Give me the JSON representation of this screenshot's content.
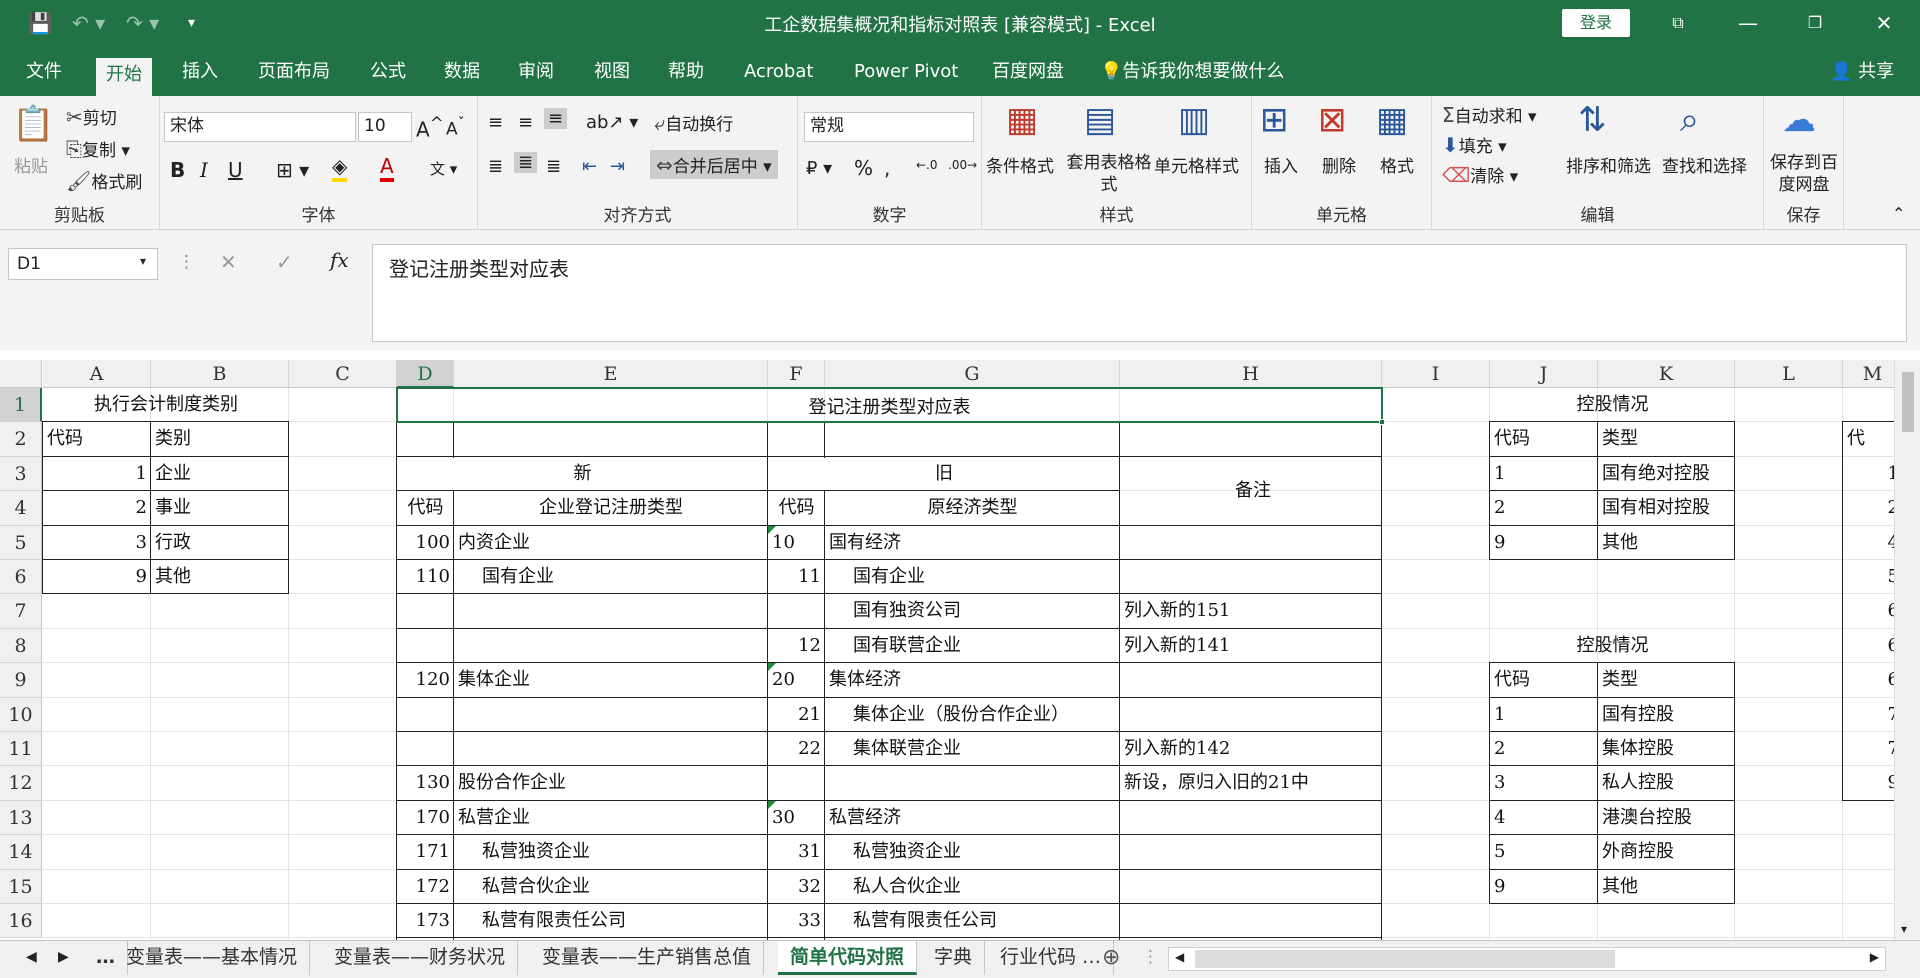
{
  "titlebar": {
    "title": "工企数据集概况和指标对照表  [兼容模式]  -  Excel",
    "login": "登录"
  },
  "menu": [
    "文件",
    "开始",
    "插入",
    "页面布局",
    "公式",
    "数据",
    "审阅",
    "视图",
    "帮助",
    "Acrobat",
    "Power Pivot",
    "百度网盘"
  ],
  "menu_search": "告诉我你想要做什么",
  "share": "共享",
  "ribbon": {
    "clipboard": {
      "paste": "粘贴",
      "cut": "剪切",
      "copy": "复制",
      "painter": "格式刷",
      "label": "剪贴板"
    },
    "font": {
      "name": "宋体",
      "size": "10",
      "bold": "B",
      "italic": "I",
      "underline": "U",
      "label": "字体"
    },
    "align": {
      "wrap": "自动换行",
      "merge": "合并后居中",
      "label": "对齐方式"
    },
    "number": {
      "format": "常规",
      "label": "数字"
    },
    "styles": {
      "cond": "条件格式",
      "table": "套用表格格式",
      "cell": "单元格样式",
      "label": "样式"
    },
    "cells": {
      "insert": "插入",
      "delete": "删除",
      "format": "格式",
      "label": "单元格"
    },
    "edit": {
      "autosum": "自动求和",
      "fill": "填充",
      "clear": "清除",
      "sort": "排序和筛选",
      "find": "查找和选择",
      "label": "编辑"
    },
    "save": {
      "baidu": "保存到百度网盘",
      "label": "保存"
    }
  },
  "formula": {
    "namebox": "D1",
    "content": "登记注册类型对应表"
  },
  "columns": [
    "A",
    "B",
    "C",
    "D",
    "E",
    "F",
    "G",
    "H",
    "I",
    "J",
    "K",
    "L",
    "M"
  ],
  "rows": [
    "1",
    "2",
    "3",
    "4",
    "5",
    "6",
    "7",
    "8",
    "9",
    "10",
    "11",
    "12",
    "13",
    "14",
    "15",
    "16"
  ],
  "sheet": {
    "A1": "执行会计制度类别",
    "A2": "代码",
    "B2": "类别",
    "A3": "1",
    "B3": "企业",
    "A4": "2",
    "B4": "事业",
    "A5": "3",
    "B5": "行政",
    "A6": "9",
    "B6": "其他",
    "D1": "登记注册类型对应表",
    "E3": "新",
    "G3": "旧",
    "H3": "备注",
    "D4": "代码",
    "E4": "企业登记注册类型",
    "F4": "代码",
    "G4": "原经济类型",
    "D5": "100",
    "E5": "内资企业",
    "F5": "10",
    "G5": "国有经济",
    "D6": "110",
    "E6": "国有企业",
    "F6": "11",
    "G6": "国有企业",
    "G7": "国有独资公司",
    "H7": "列入新的151",
    "F8": "12",
    "G8": "国有联营企业",
    "H8": "列入新的141",
    "D9": "120",
    "E9": "集体企业",
    "F9": "20",
    "G9": "集体经济",
    "F10": "21",
    "G10": "集体企业（股份合作企业）",
    "F11": "22",
    "G11": "集体联营企业",
    "H11": "列入新的142",
    "D12": "130",
    "E12": "股份合作企业",
    "H12": "新设，原归入旧的21中",
    "D13": "170",
    "E13": "私营企业",
    "F13": "30",
    "G13": "私营经济",
    "D14": "171",
    "E14": "私营独资企业",
    "F14": "31",
    "G14": "私营独资企业",
    "D15": "172",
    "E15": "私营合伙企业",
    "F15": "32",
    "G15": "私人合伙企业",
    "D16": "173",
    "E16": "私营有限责任公司",
    "F16": "33",
    "G16": "私营有限责任公司",
    "J1": "控股情况",
    "J2": "代码",
    "K2": "类型",
    "J3": "1",
    "K3": "国有绝对控股",
    "J4": "2",
    "K4": "国有相对控股",
    "J5": "9",
    "K5": "其他",
    "J8": "控股情况",
    "J9": "代码",
    "K9": "类型",
    "J10": "1",
    "K10": "国有控股",
    "J11": "2",
    "K11": "集体控股",
    "J12": "3",
    "K12": "私人控股",
    "J13": "4",
    "K13": "港澳台控股",
    "J14": "5",
    "K14": "外商控股",
    "J15": "9",
    "K15": "其他",
    "M2": "代",
    "M3": "1",
    "M4": "2",
    "M5": "4",
    "M6": "5",
    "M7": "6",
    "M8": "6",
    "M9": "6",
    "M10": "7",
    "M11": "7",
    "M12": "9"
  },
  "tabs": [
    "…",
    "变量表——基本情况",
    "变量表——财务状况",
    "变量表——生产销售总值",
    "简单代码对照",
    "字典",
    "行业代码 …"
  ]
}
